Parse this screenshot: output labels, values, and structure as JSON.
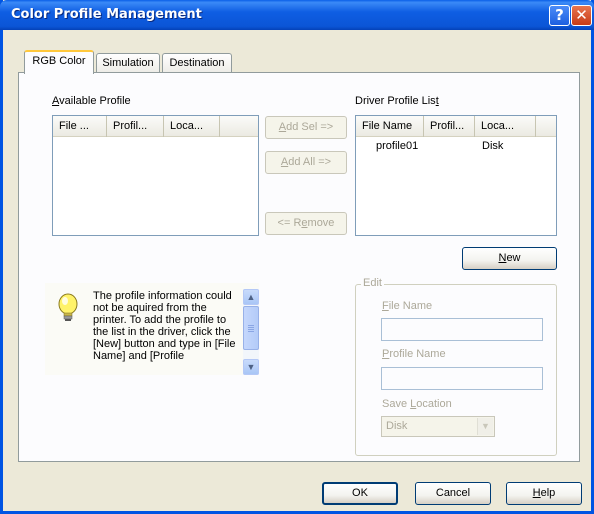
{
  "window": {
    "title": "Color Profile Management",
    "help_glyph": "?",
    "close_glyph": "✕"
  },
  "tabs": [
    {
      "label": "RGB Color",
      "active": true
    },
    {
      "label": "Simulation",
      "active": false
    },
    {
      "label": "Destination",
      "active": false
    }
  ],
  "available": {
    "label_mnemonic": "A",
    "label_rest": "vailable Profile",
    "columns": [
      "File ...",
      "Profil...",
      "Loca..."
    ],
    "rows": []
  },
  "driver": {
    "label_prefix": "Driver Profile Lis",
    "label_mnemonic": "t",
    "columns": [
      "File Name",
      "Profil...",
      "Loca..."
    ],
    "rows": [
      {
        "file": "profile01",
        "profile": "",
        "location": "Disk"
      }
    ]
  },
  "middle_buttons": {
    "add_sel": {
      "m": "A",
      "rest": "dd Sel =>"
    },
    "add_all": {
      "m": "A",
      "rest": "dd All =>"
    },
    "remove": {
      "pre": "<= R",
      "m": "e",
      "rest": "move"
    }
  },
  "new_button": {
    "m": "N",
    "rest": "ew"
  },
  "info": {
    "text": "The profile information could not be aquired from the printer.  To add the profile to the list in the driver, click the [New] button and type in [File Name] and [Profile",
    "scroll_up": "▲",
    "scroll_down": "▼"
  },
  "edit": {
    "caption": "Edit",
    "file_name": {
      "m": "F",
      "rest": "ile Name",
      "value": ""
    },
    "profile_name": {
      "m": "P",
      "rest": "rofile Name",
      "value": ""
    },
    "save_location": {
      "pre": "Save ",
      "m": "L",
      "rest": "ocation",
      "value": "Disk",
      "arrow": "▼"
    }
  },
  "footer": {
    "ok": "OK",
    "cancel": "Cancel",
    "help": {
      "m": "H",
      "rest": "elp"
    }
  },
  "colors": {
    "title_bar": "#0b55d6",
    "dialog_bg": "#ece9d8",
    "tab_highlight": "#ffc83c"
  }
}
